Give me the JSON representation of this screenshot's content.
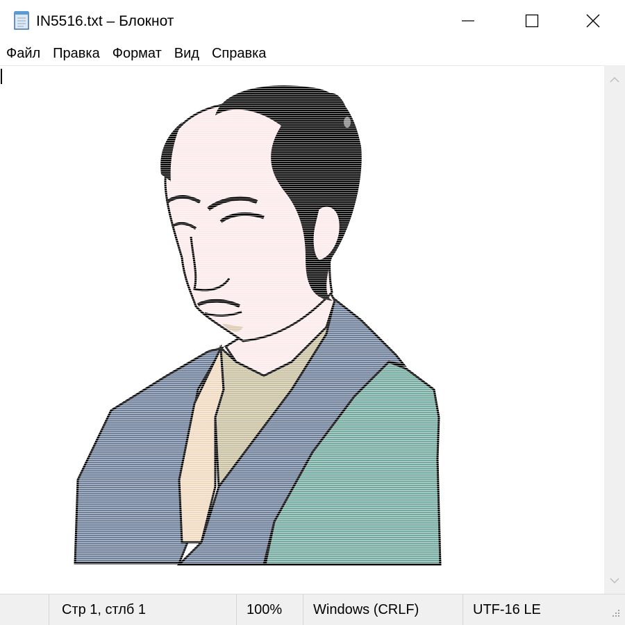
{
  "window": {
    "title": "IN5516.txt – Блокнот",
    "app_icon": "notepad-icon",
    "controls": [
      "minimize-icon",
      "maximize-icon",
      "close-icon"
    ]
  },
  "menu": {
    "items": [
      "Файл",
      "Правка",
      "Формат",
      "Вид",
      "Справка"
    ]
  },
  "editor": {
    "content_type": "ascii-art portrait of a samurai rendered with colored text lines",
    "colors": {
      "hair": "#0a0a0a",
      "skin": "#fdeaea",
      "robe_blue": "#6e7f99",
      "robe_green": "#74aaa0",
      "under_robe": "#f1d9c0",
      "inner_collar": "#c9c0a1",
      "outline": "#000000"
    }
  },
  "scrollbar": {
    "up_icon": "chevron-up-icon",
    "down_icon": "chevron-down-icon"
  },
  "status": {
    "position": "Стр 1, стлб 1",
    "zoom": "100%",
    "line_endings": "Windows (CRLF)",
    "encoding": "UTF-16 LE"
  }
}
